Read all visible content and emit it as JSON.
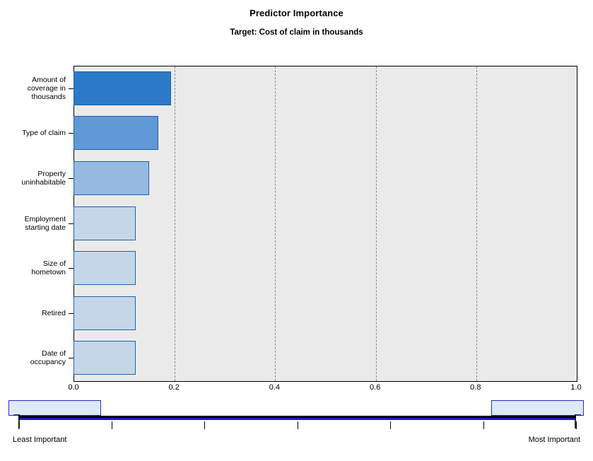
{
  "chart_data": {
    "type": "bar",
    "orientation": "horizontal",
    "title": "Predictor Importance",
    "subtitle": "Target: Cost of claim in thousands",
    "xlabel": "",
    "ylabel": "",
    "xlim": [
      0.0,
      1.0
    ],
    "xticks": [
      "0.0",
      "0.2",
      "0.4",
      "0.6",
      "0.8",
      "1.0"
    ],
    "xtick_values": [
      0.0,
      0.2,
      0.4,
      0.6,
      0.8,
      1.0
    ],
    "grid": true,
    "grid_axis": "x",
    "legend": "none",
    "categories": [
      "Amount of\ncoverage in\nthousands",
      "Type of claim",
      "Property\nuninhabitable",
      "Employment\nstarting date",
      "Size of\nhometown",
      "Retired",
      "Date of\noccupancy"
    ],
    "values": [
      0.194,
      0.169,
      0.15,
      0.124,
      0.124,
      0.124,
      0.124
    ],
    "bar_colors": [
      "#2b7bc8",
      "#6199d6",
      "#97b9e0",
      "#c5d6e8",
      "#c5d6e8",
      "#c5d6e8",
      "#c5d6e8"
    ],
    "bar_border_color": "#1f62ad",
    "plot_background": "#eaeaea",
    "gridline_color": "#8a8a8a"
  },
  "slider": {
    "name": "importance-filter-slider",
    "left_label": "Least Important",
    "right_label": "Most Important",
    "left_handle_value": 0.0,
    "right_handle_value": 1.0,
    "tick_count": 7,
    "track_color": "#1a1ac8",
    "handle_fill": "#dfe9f7",
    "handle_border": "#2a2ac0"
  }
}
